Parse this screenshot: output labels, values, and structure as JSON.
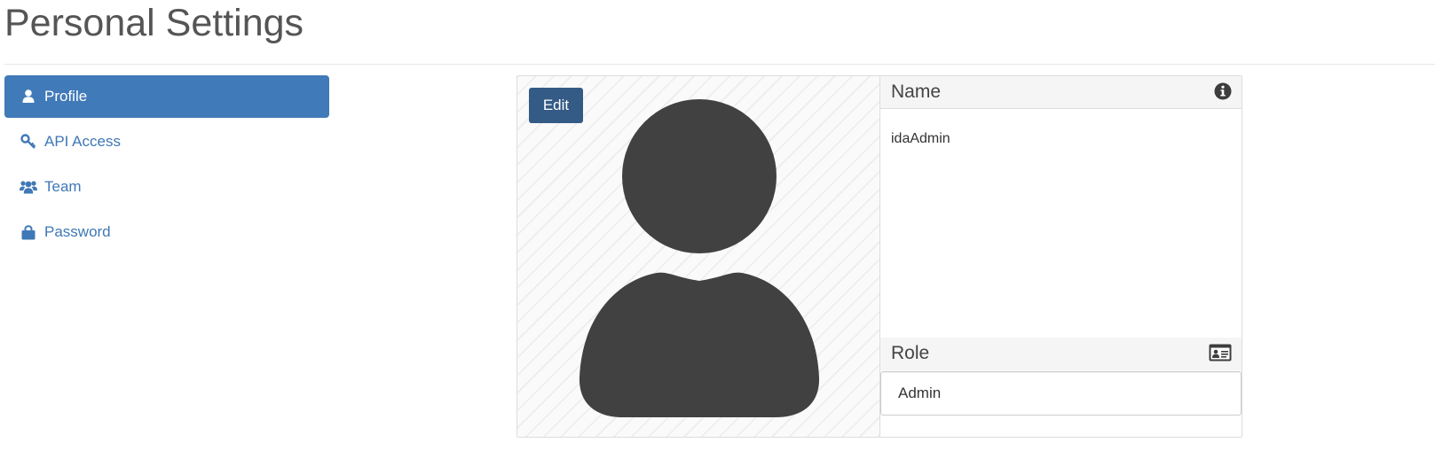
{
  "page": {
    "title": "Personal Settings"
  },
  "sidebar": {
    "items": [
      {
        "label": "Profile",
        "icon": "user-icon",
        "active": true
      },
      {
        "label": "API Access",
        "icon": "key-icon",
        "active": false
      },
      {
        "label": "Team",
        "icon": "users-icon",
        "active": false
      },
      {
        "label": "Password",
        "icon": "lock-icon",
        "active": false
      }
    ]
  },
  "profile": {
    "edit_label": "Edit",
    "avatar_icon": "user-silhouette-icon",
    "name_header": "Name",
    "name_header_icon": "info-circle-icon",
    "name_value": "idaAdmin",
    "role_header": "Role",
    "role_header_icon": "id-card-icon",
    "role_value": "Admin"
  },
  "colors": {
    "accent": "#417ab8",
    "link": "#3f78b6",
    "edit_button": "#345b85",
    "avatar": "#414141"
  }
}
